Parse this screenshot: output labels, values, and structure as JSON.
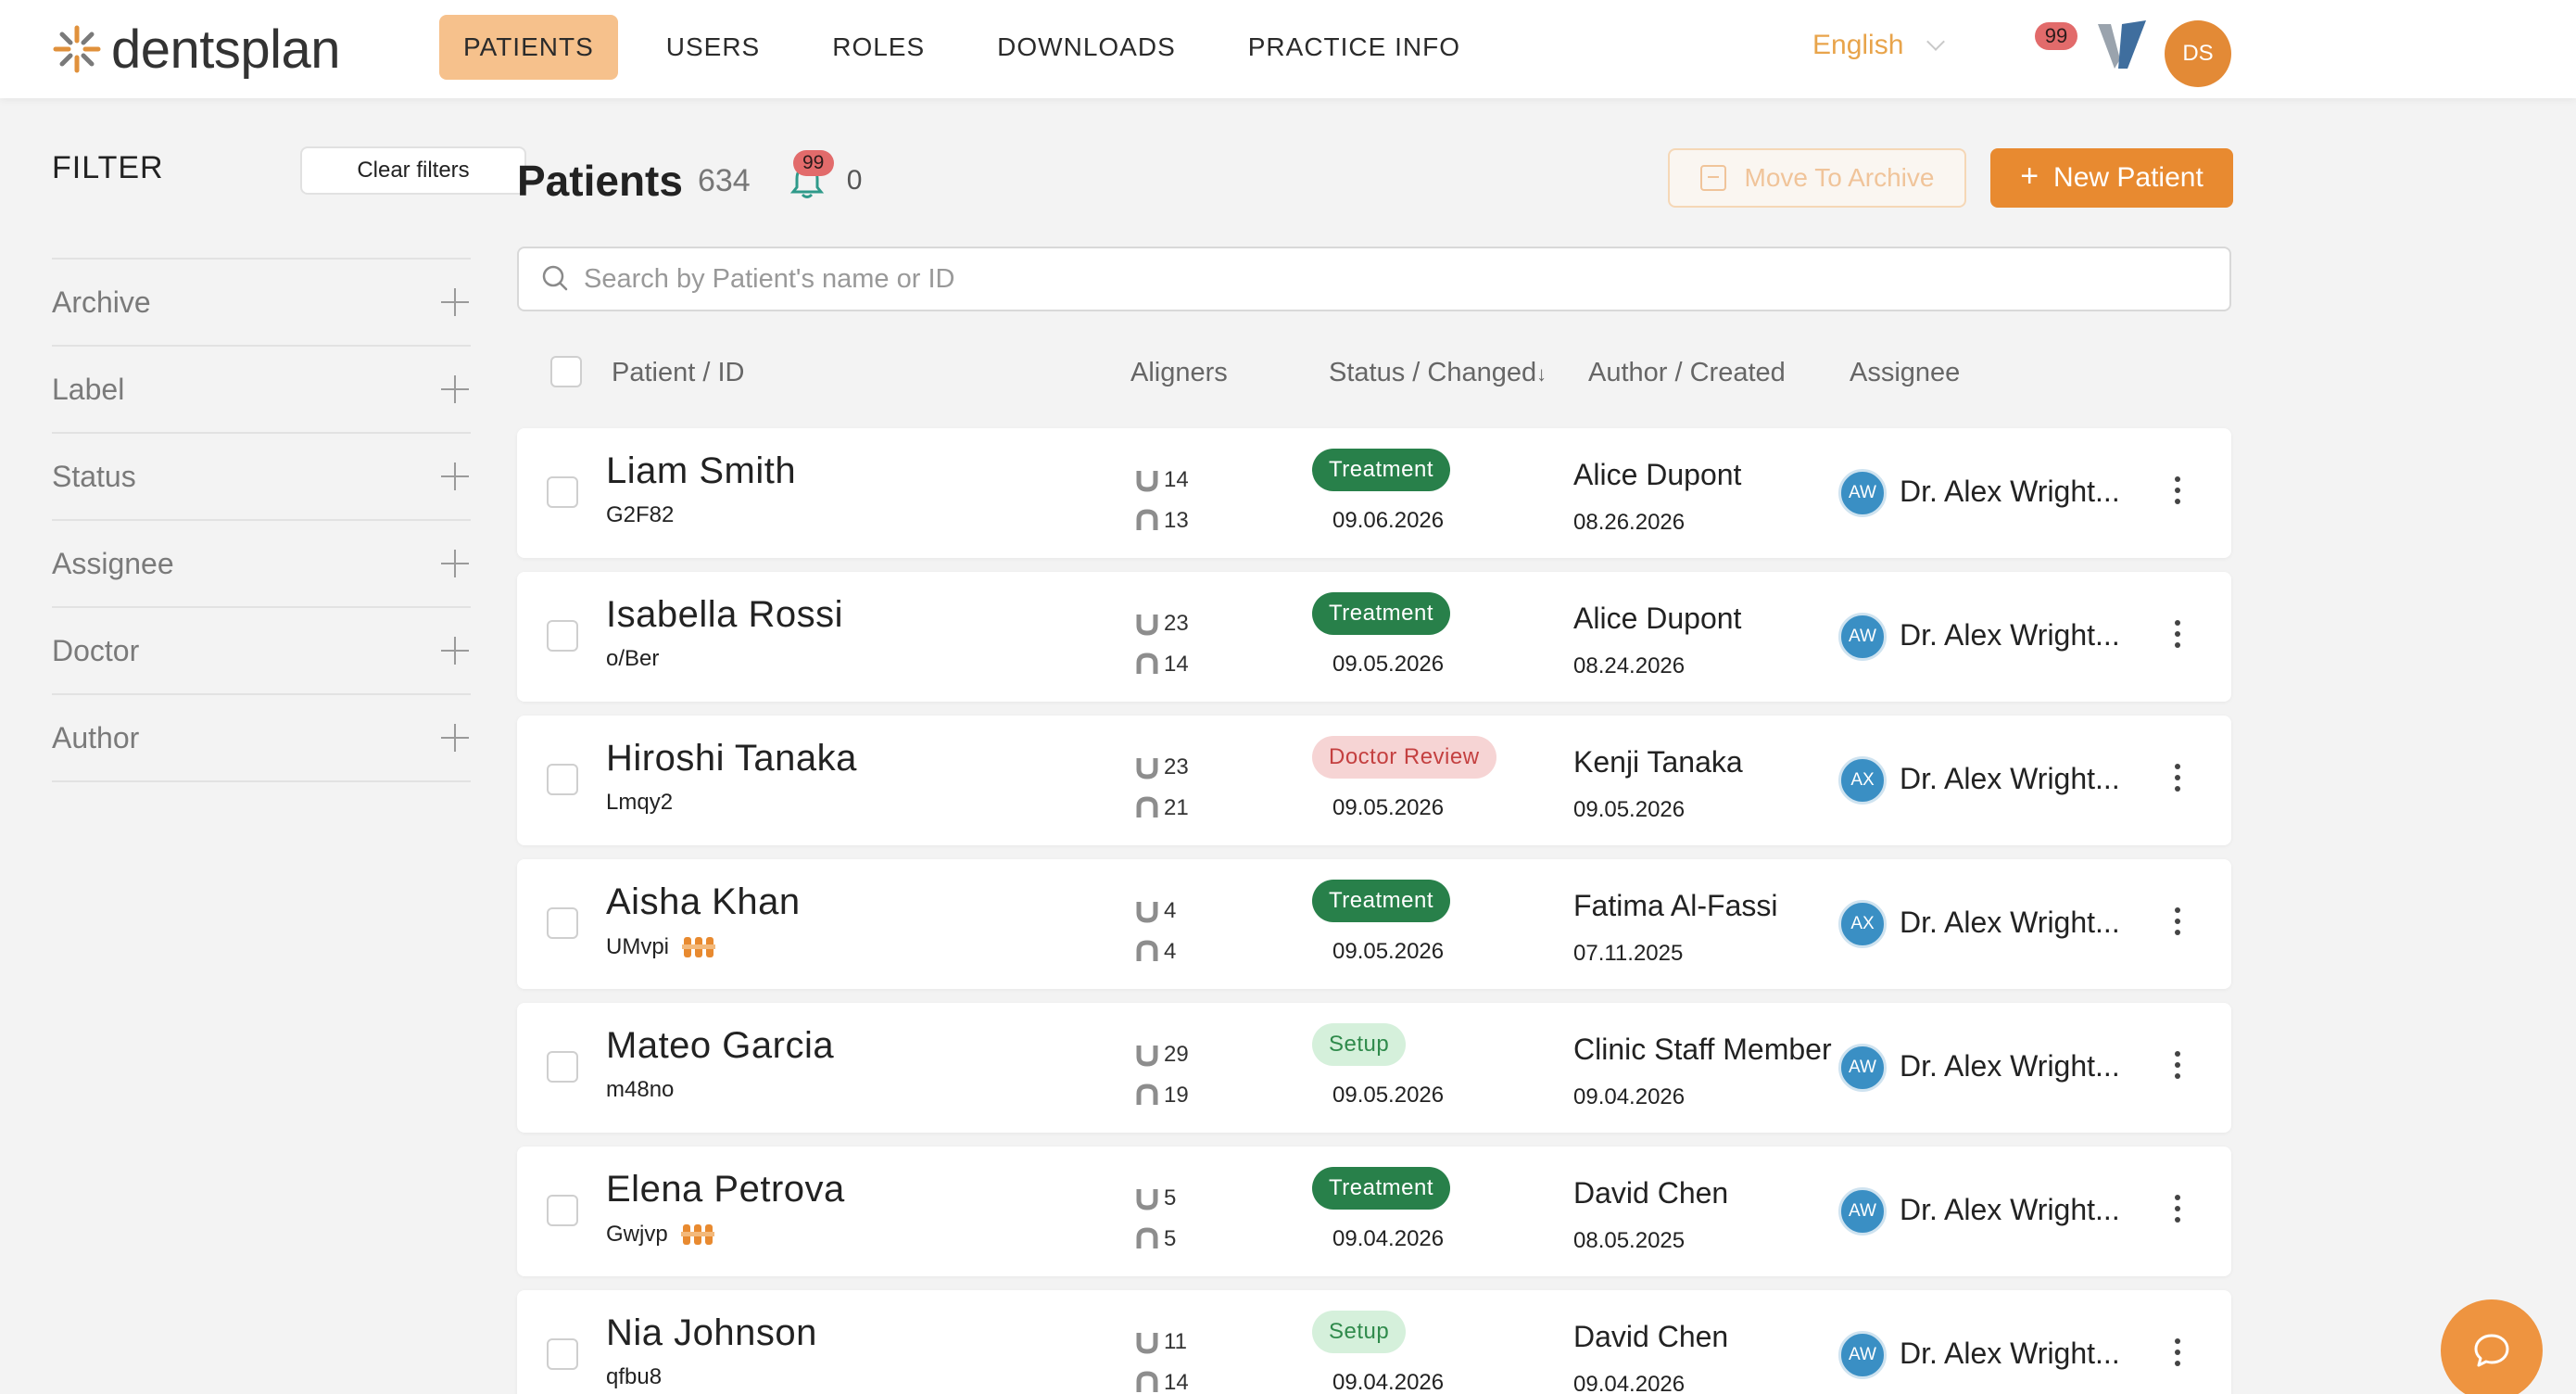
{
  "app": {
    "brand": "dentsplan"
  },
  "nav": {
    "items": [
      {
        "label": "PATIENTS",
        "active": true
      },
      {
        "label": "USERS",
        "active": false
      },
      {
        "label": "ROLES",
        "active": false
      },
      {
        "label": "DOWNLOADS",
        "active": false
      },
      {
        "label": "PRACTICE INFO",
        "active": false
      }
    ],
    "language": "English",
    "notifications_badge": "99",
    "user_initials": "DS"
  },
  "filter": {
    "title": "FILTER",
    "clear_label": "Clear filters",
    "items": [
      "Archive",
      "Label",
      "Status",
      "Assignee",
      "Doctor",
      "Author"
    ]
  },
  "main": {
    "title": "Patients",
    "count": "634",
    "bell_badge": "99",
    "bell_count": "0",
    "archive_label": "Move To Archive",
    "new_label": "New Patient",
    "search_placeholder": "Search by Patient's name or ID"
  },
  "table": {
    "headers": {
      "patient": "Patient / ID",
      "aligners": "Aligners",
      "status": "Status / Changed",
      "author": "Author / Created",
      "assignee": "Assignee"
    },
    "rows": [
      {
        "name": "Liam Smith",
        "id": "G2F82",
        "braces": false,
        "upper": "14",
        "lower": "13",
        "status": "Treatment",
        "status_kind": "treatment",
        "changed": "09.06.2026",
        "author": "Alice Dupont",
        "created": "08.26.2026",
        "assignee_initials": "AW",
        "assignee": "Dr. Alex Wright..."
      },
      {
        "name": "Isabella Rossi",
        "id": "o/Ber",
        "braces": false,
        "upper": "23",
        "lower": "14",
        "status": "Treatment",
        "status_kind": "treatment",
        "changed": "09.05.2026",
        "author": "Alice Dupont",
        "created": "08.24.2026",
        "assignee_initials": "AW",
        "assignee": "Dr. Alex Wright..."
      },
      {
        "name": "Hiroshi Tanaka",
        "id": "Lmqy2",
        "braces": false,
        "upper": "23",
        "lower": "21",
        "status": "Doctor Review",
        "status_kind": "review",
        "changed": "09.05.2026",
        "author": "Kenji Tanaka",
        "created": "09.05.2026",
        "assignee_initials": "AX",
        "assignee": "Dr. Alex Wright..."
      },
      {
        "name": "Aisha Khan",
        "id": "UMvpi",
        "braces": true,
        "upper": "4",
        "lower": "4",
        "status": "Treatment",
        "status_kind": "treatment",
        "changed": "09.05.2026",
        "author": "Fatima Al-Fassi",
        "created": "07.11.2025",
        "assignee_initials": "AX",
        "assignee": "Dr. Alex Wright..."
      },
      {
        "name": "Mateo Garcia",
        "id": "m48no",
        "braces": false,
        "upper": "29",
        "lower": "19",
        "status": "Setup",
        "status_kind": "setup",
        "changed": "09.05.2026",
        "author": "Clinic Staff Member",
        "created": "09.04.2026",
        "assignee_initials": "AW",
        "assignee": "Dr. Alex Wright..."
      },
      {
        "name": "Elena Petrova",
        "id": "Gwjvp",
        "braces": true,
        "upper": "5",
        "lower": "5",
        "status": "Treatment",
        "status_kind": "treatment",
        "changed": "09.04.2026",
        "author": "David Chen",
        "created": "08.05.2025",
        "assignee_initials": "AW",
        "assignee": "Dr. Alex Wright..."
      },
      {
        "name": "Nia Johnson",
        "id": "qfbu8",
        "braces": false,
        "upper": "11",
        "lower": "14",
        "status": "Setup",
        "status_kind": "setup",
        "changed": "09.04.2026",
        "author": "David Chen",
        "created": "09.04.2026",
        "assignee_initials": "AW",
        "assignee": "Dr. Alex Wright..."
      }
    ]
  },
  "colors": {
    "accent": "#e88a30",
    "nav_active": "#f6c18c",
    "treatment": "#28804a",
    "review_bg": "#f6d4d4",
    "setup_bg": "#d5f0db",
    "assignee_avatar": "#3a8fc4"
  },
  "icons": [
    "dentsplan-logo-icon",
    "chevron-down-icon",
    "bell-icon",
    "archive-box-icon",
    "plus-icon",
    "search-icon",
    "upper-aligner-icon",
    "lower-aligner-icon",
    "braces-icon",
    "kebab-menu-icon",
    "chat-icon"
  ]
}
